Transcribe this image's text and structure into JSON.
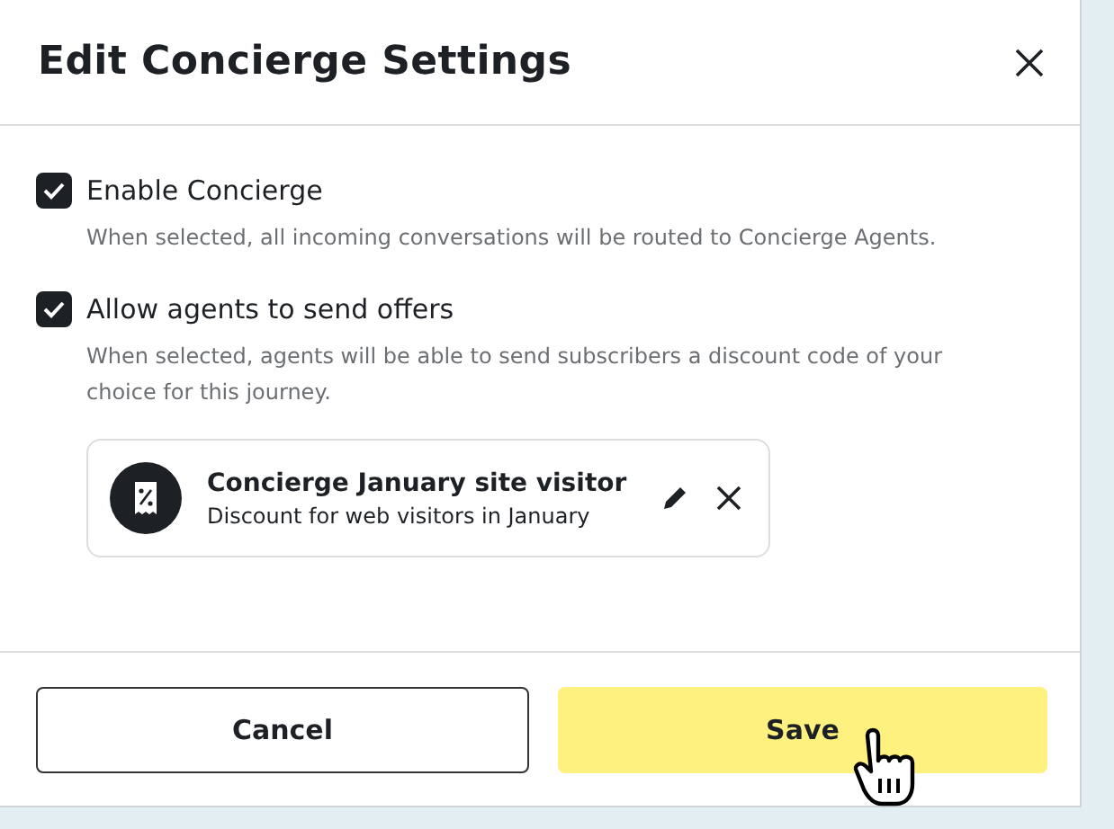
{
  "dialog": {
    "title": "Edit Concierge Settings"
  },
  "options": [
    {
      "label": "Enable Concierge",
      "checked": true,
      "description": "When selected, all incoming conversations will be routed to Concierge Agents."
    },
    {
      "label": "Allow agents to send offers",
      "checked": true,
      "description": "When selected, agents will be able to send subscribers a discount code of your choice for this journey.",
      "offer": {
        "title": "Concierge January site visitor",
        "subtitle": "Discount for web visitors in January"
      }
    }
  ],
  "buttons": [
    {
      "label": "Cancel",
      "kind": "secondary"
    },
    {
      "label": "Save",
      "kind": "primary"
    }
  ]
}
